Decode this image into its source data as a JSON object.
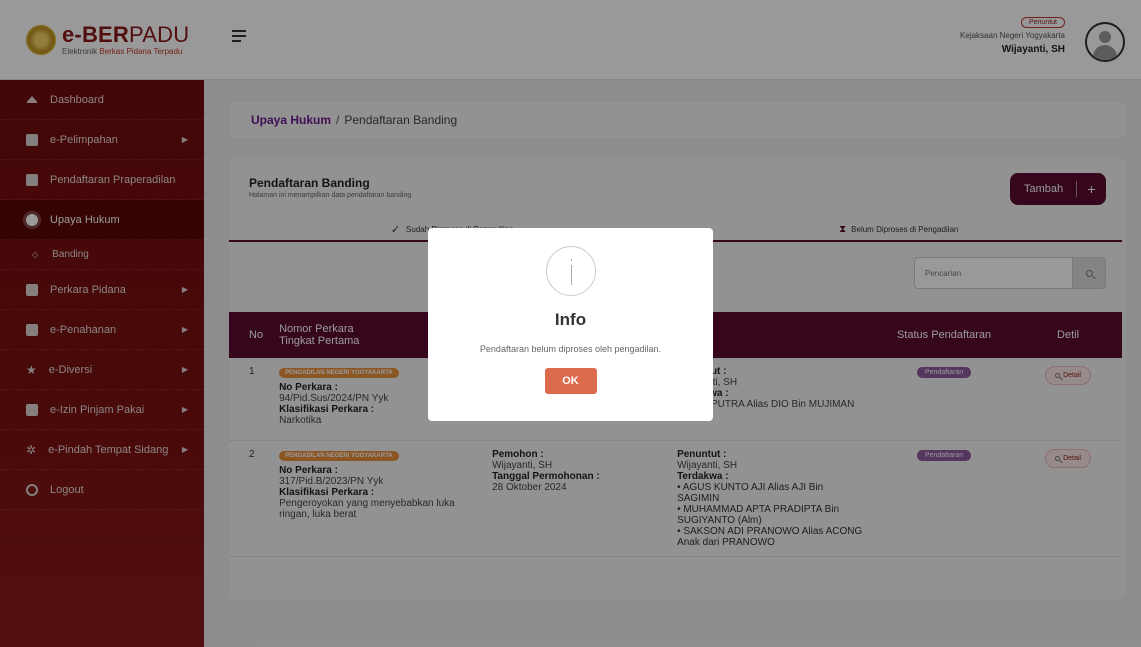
{
  "brand": {
    "title_bold": "e-BER",
    "title_rest": "PADU",
    "sub_a": "Elektronik ",
    "sub_b": "Berkas Pidana Terpadu"
  },
  "sidebar": {
    "items": [
      {
        "label": "Dashboard",
        "icon": "home-icon"
      },
      {
        "label": "e-Pelimpahan",
        "icon": "document-icon"
      },
      {
        "label": "Pendaftaran Praperadilan",
        "icon": "document-icon"
      },
      {
        "label": "Upaya Hukum",
        "icon": "document-icon"
      },
      {
        "label": "Banding",
        "icon": "diamond-icon"
      },
      {
        "label": "Perkara Pidana",
        "icon": "edit-icon"
      },
      {
        "label": "e-Penahanan",
        "icon": "grid-icon"
      },
      {
        "label": "e-Diversi",
        "icon": "star-icon"
      },
      {
        "label": "e-Izin Pinjam Pakai",
        "icon": "edit-icon"
      },
      {
        "label": "e-Pindah Tempat Sidang",
        "icon": "gear-icon"
      },
      {
        "label": "Logout",
        "icon": "power-icon"
      }
    ]
  },
  "header": {
    "role": "Penuntut",
    "org": "Kejaksaan Negeri Yogyakarta",
    "user": "Wijayanti, SH"
  },
  "breadcrumb": {
    "parent": "Upaya Hukum",
    "separator": "/",
    "current": "Pendaftaran Banding"
  },
  "main": {
    "title": "Pendaftaran Banding",
    "subtitle": "Halaman ini menampilkan data pendaftaran banding",
    "add_label": "Tambah",
    "add_plus": "+",
    "tabs": [
      "Sudah Diproses di Pengadilan",
      "Belum Diproses di Pengadilan"
    ],
    "search_placeholder": "Pencarian",
    "columns": [
      "No",
      "Nomor Perkara Tingkat Pertama",
      "",
      "Pihak",
      "Status Pendaftaran",
      "Detil"
    ],
    "col_no": "No",
    "col_nomor_1": "Nomor Perkara",
    "col_nomor_2": "Tingkat Pertama",
    "col_pihak": "Pihak",
    "col_status": "Status Pendaftaran",
    "col_detil": "Detil",
    "rows": [
      {
        "no": "1",
        "court": "PENGADILAN NEGERI YOGYAKARTA",
        "nomor_label": "No Perkara :",
        "nomor": "94/Pid.Sus/2024/PN Yyk",
        "klas_label": "Klasifikasi Perkara :",
        "klas": "Narkotika",
        "penuntut_label": "Penuntut :",
        "penuntut": "Wijayanti, SH",
        "terdakwa_label": "Terdakwa :",
        "terdakwa": "DIO SAPUTRA Alias DIO Bin MUJIMAN",
        "status": "Pendaftaran",
        "detail": "Detail"
      },
      {
        "no": "2",
        "court": "PENGADILAN NEGERI YOGYAKARTA",
        "nomor_label": "No Perkara :",
        "nomor": "317/Pid.B/2023/PN Yyk",
        "klas_label": "Klasifikasi Perkara :",
        "klas": "Pengeroyokan yang menyebabkan luka ringan, luka berat",
        "pemohon_label": "Pemohon :",
        "pemohon": "Wijayanti, SH",
        "tgl_label": "Tanggal Permohonan :",
        "tgl": "28 Oktober 2024",
        "penuntut_label": "Penuntut :",
        "penuntut": "Wijayanti, SH",
        "terdakwa_label": "Terdakwa :",
        "terdakwa_list": [
          "AGUS KUNTO AJI Alias AJI Bin SAGIMIN",
          "MUHAMMAD APTA PRADIPTA Bin SUGIYANTO (Alm)",
          "SAKSON ADI PRANOWO Alias ACONG Anak dari PRANOWO"
        ],
        "status": "Pendaftaran",
        "detail": "Detail"
      }
    ]
  },
  "modal": {
    "icon": "info-icon",
    "title": "Info",
    "message": "Pendaftaran belum diproses oleh pengadilan.",
    "ok_label": "OK"
  },
  "colors": {
    "brand": "#8b1a1a",
    "sidebar": "#6d0a0a",
    "table_header": "#5a0d2f",
    "ok_button": "#dc6b4e",
    "status_badge": "#8e5a9e",
    "court_badge": "#e8903c"
  }
}
